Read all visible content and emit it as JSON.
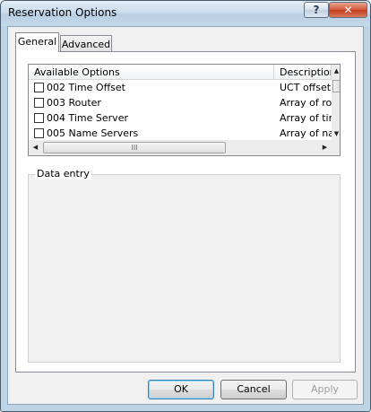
{
  "window": {
    "title": "Reservation Options"
  },
  "titlebar": {
    "help_glyph": "?",
    "close_glyph": "✕"
  },
  "tabs": [
    {
      "label": "General",
      "selected": true
    },
    {
      "label": "Advanced",
      "selected": false
    }
  ],
  "options_list": {
    "columns": [
      "Available Options",
      "Description"
    ],
    "rows": [
      {
        "option": "002 Time Offset",
        "description": "UCT offset i",
        "checked": false
      },
      {
        "option": "003 Router",
        "description": "Array of rout",
        "checked": false
      },
      {
        "option": "004 Time Server",
        "description": "Array of time",
        "checked": false
      },
      {
        "option": "005 Name Servers",
        "description": "Array of nam",
        "checked": false
      }
    ],
    "hscroll_thumb_grip": "III"
  },
  "data_entry": {
    "legend": "Data entry"
  },
  "buttons": {
    "ok": "OK",
    "cancel": "Cancel",
    "apply": "Apply"
  },
  "colors": {
    "title_gradient": "#c9dced",
    "close_button": "#c23a1b",
    "default_button_border": "#3c7fb1"
  }
}
